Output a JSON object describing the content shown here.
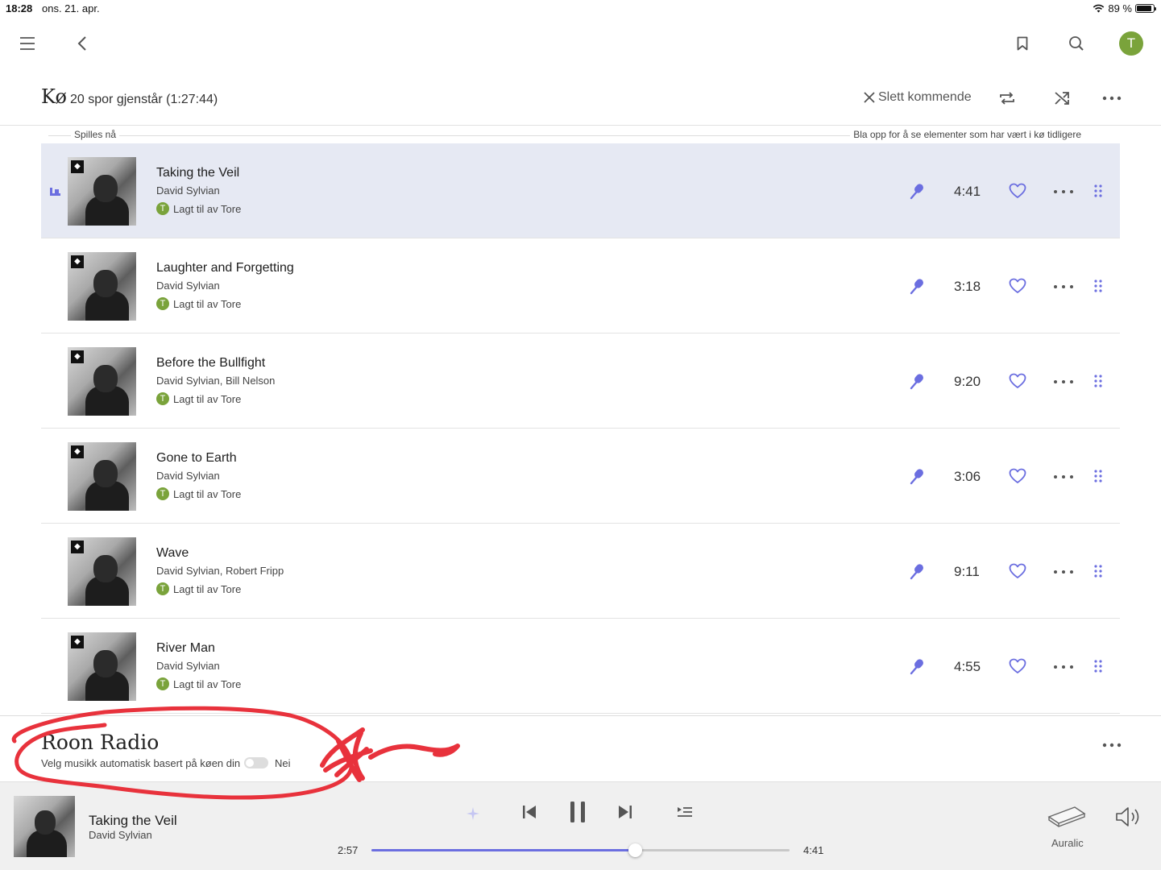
{
  "status_bar": {
    "time": "18:28",
    "date": "ons. 21. apr.",
    "battery": "89 %"
  },
  "queue": {
    "title": "Kø",
    "subtitle": "20 spor gjenstår (1:27:44)",
    "clear_label": "Slett kommende",
    "now_playing_label": "Spilles nå",
    "scroll_hint": "Bla opp for å se elementer som har vært i kø tidligere",
    "tracks": [
      {
        "title": "Taking the Veil",
        "artist": "David Sylvian",
        "added_by": "Lagt til av Tore",
        "duration": "4:41"
      },
      {
        "title": "Laughter and Forgetting",
        "artist": "David Sylvian",
        "added_by": "Lagt til av Tore",
        "duration": "3:18"
      },
      {
        "title": "Before the Bullfight",
        "artist": "David Sylvian, Bill Nelson",
        "added_by": "Lagt til av Tore",
        "duration": "9:20"
      },
      {
        "title": "Gone to Earth",
        "artist": "David Sylvian",
        "added_by": "Lagt til av Tore",
        "duration": "3:06"
      },
      {
        "title": "Wave",
        "artist": "David Sylvian, Robert Fripp",
        "added_by": "Lagt til av Tore",
        "duration": "9:11"
      },
      {
        "title": "River Man",
        "artist": "David Sylvian",
        "added_by": "Lagt til av Tore",
        "duration": "4:55"
      }
    ]
  },
  "user": {
    "initial": "T"
  },
  "radio": {
    "title": "Roon Radio",
    "subtitle": "Velg musikk automatisk basert på køen din",
    "toggle_label": "Nei",
    "enabled": false
  },
  "now_playing": {
    "title": "Taking the Veil",
    "artist": "David Sylvian",
    "elapsed": "2:57",
    "total": "4:41",
    "progress_fraction": 0.63,
    "zone": "Auralic"
  },
  "colors": {
    "accent": "#6b6ee0",
    "avatar": "#7aa33b",
    "current_row": "#e6e9f3",
    "annotation": "#e8323c"
  }
}
